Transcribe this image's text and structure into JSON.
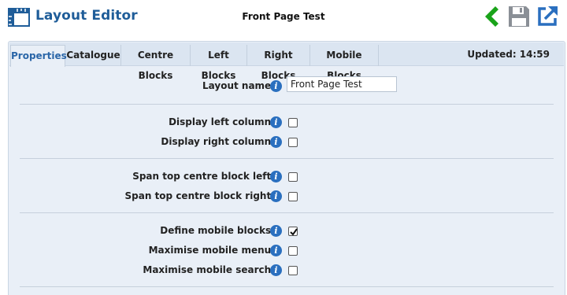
{
  "header": {
    "app_title": "Layout Editor",
    "document_title": "Front Page Test",
    "icons": {
      "logo": "layout-ruler-icon",
      "back": "back-arrow-icon",
      "save": "floppy-disk-icon",
      "open": "external-link-icon"
    },
    "colors": {
      "brand": "#1f5d99",
      "back": "#1aa31a",
      "save": "#8a8f96",
      "open": "#2a6fbf"
    }
  },
  "tabs": [
    {
      "label": "Properties",
      "active": true
    },
    {
      "label": "Catalogue",
      "active": false
    },
    {
      "label": "Centre Blocks",
      "active": false
    },
    {
      "label": "Left Blocks",
      "active": false
    },
    {
      "label": "Right Blocks",
      "active": false
    },
    {
      "label": "Mobile Blocks",
      "active": false
    }
  ],
  "status": {
    "updated": "Updated: 14:59"
  },
  "form": {
    "layout_name": {
      "label": "Layout name:",
      "value": "Front Page Test"
    },
    "display_left_column": {
      "label": "Display left column:",
      "checked": false
    },
    "display_right_column": {
      "label": "Display right column:",
      "checked": false
    },
    "span_top_centre_left": {
      "label": "Span top centre block left:",
      "checked": false
    },
    "span_top_centre_right": {
      "label": "Span top centre block right:",
      "checked": false
    },
    "define_mobile_blocks": {
      "label": "Define mobile blocks:",
      "checked": true
    },
    "maximise_mobile_menu": {
      "label": "Maximise mobile menu:",
      "checked": false
    },
    "maximise_mobile_search": {
      "label": "Maximise mobile search:",
      "checked": false
    },
    "info_glyph": "i"
  }
}
